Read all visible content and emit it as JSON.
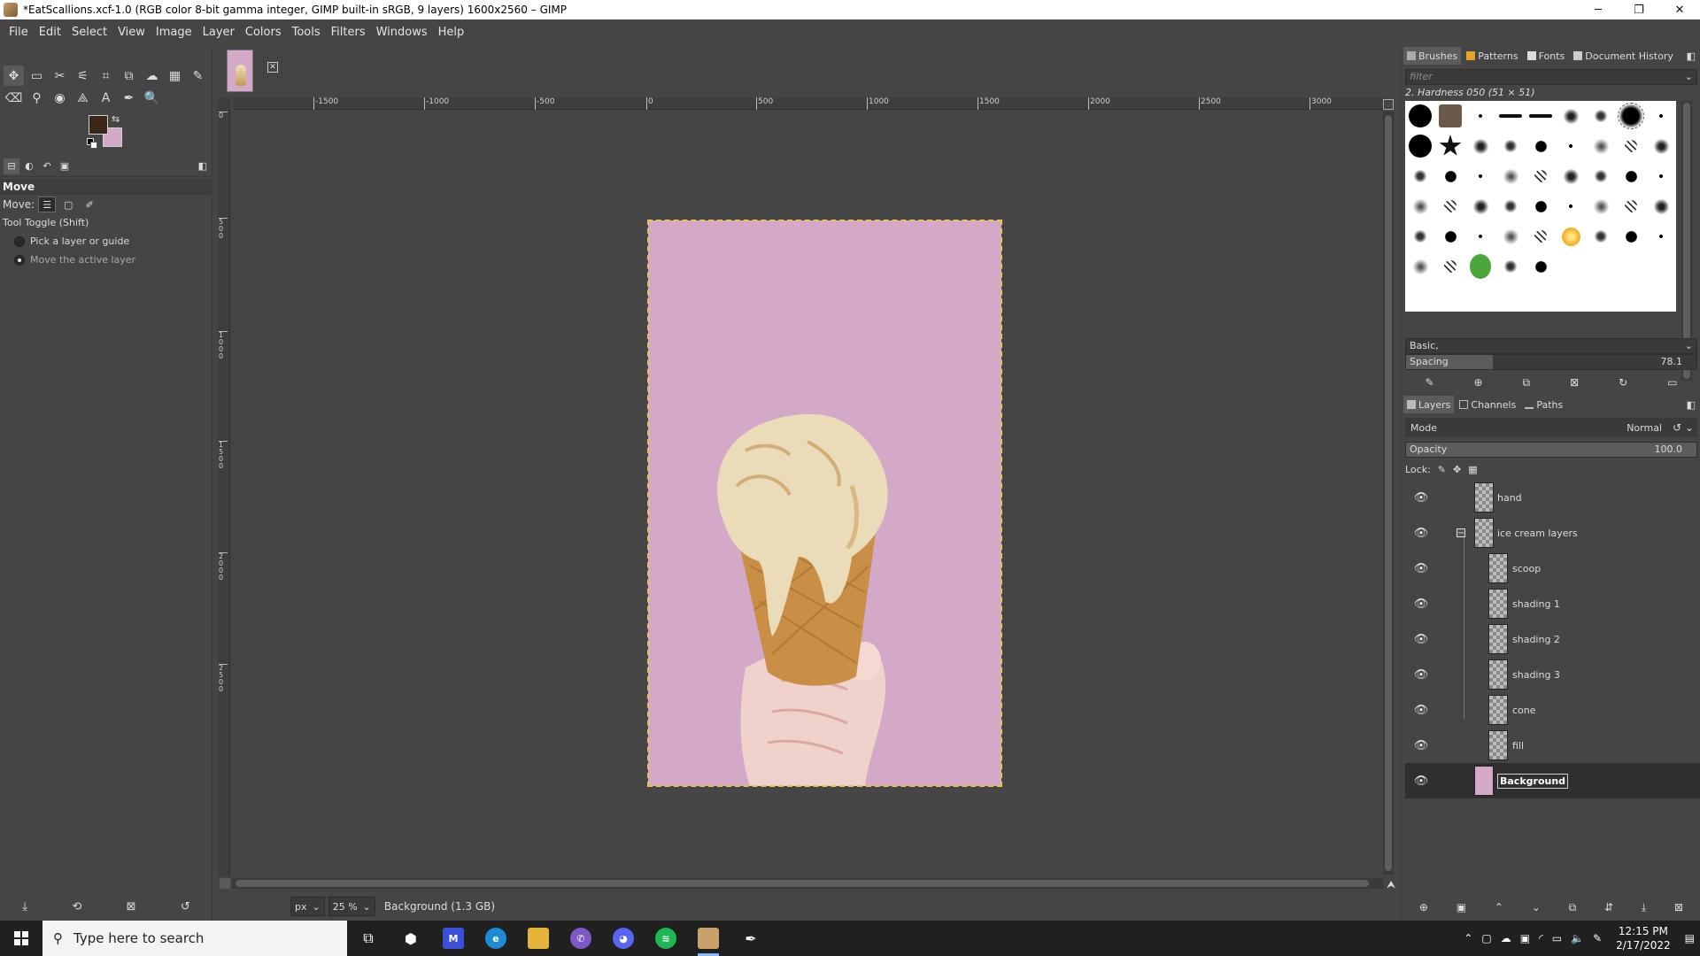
{
  "window": {
    "title": "*EatScallions.xcf-1.0 (RGB color 8-bit gamma integer, GIMP built-in sRGB, 9 layers) 1600x2560 – GIMP",
    "minimize": "─",
    "maximize": "❐",
    "close": "✕"
  },
  "menu": [
    "File",
    "Edit",
    "Select",
    "View",
    "Image",
    "Layer",
    "Colors",
    "Tools",
    "Filters",
    "Windows",
    "Help"
  ],
  "toolbox": {
    "row1_icons": [
      "move-icon",
      "rect-select-icon",
      "free-select-icon",
      "fuzzy-select-icon",
      "crop-icon",
      "unified-transform-icon",
      "warp-icon",
      "gradient-icon",
      "smudge-icon"
    ],
    "row2_icons": [
      "eraser-icon",
      "clone-icon",
      "bucket-fill-icon",
      "perspective-icon",
      "text-icon",
      "color-picker-icon",
      "zoom-icon"
    ],
    "fg_color": "#3a2718",
    "bg_color": "#d4a8c7"
  },
  "tool_options": {
    "title": "Move",
    "move_label": "Move:",
    "toggle_label": "Tool Toggle  (Shift)",
    "radio1": "Pick a layer or guide",
    "radio2": "Move the active layer"
  },
  "ruler": {
    "h": [
      "-1500",
      "-1000",
      "-500",
      "0",
      "500",
      "1000",
      "1500",
      "2000",
      "2500",
      "3000"
    ],
    "v": [
      "0",
      "500",
      "1000",
      "1500",
      "2000",
      "2500"
    ]
  },
  "status": {
    "unit": "px",
    "zoom": "25 %",
    "message": "Background (1.3 GB)"
  },
  "brushes": {
    "tabs": [
      "Brushes",
      "Patterns",
      "Fonts",
      "Document History"
    ],
    "filter_placeholder": "filter",
    "current": "2. Hardness 050 (51 × 51)",
    "preset": "Basic,",
    "spacing_label": "Spacing",
    "spacing_value": "78.1"
  },
  "layers": {
    "tabs": [
      "Layers",
      "Channels",
      "Paths"
    ],
    "mode_label": "Mode",
    "mode_value": "Normal",
    "opacity_label": "Opacity",
    "opacity_value": "100.0",
    "lock_label": "Lock:",
    "items": [
      {
        "name": "hand",
        "level": 0
      },
      {
        "name": "ice cream layers",
        "level": 0,
        "group": true
      },
      {
        "name": "scoop",
        "level": 1
      },
      {
        "name": "shading 1",
        "level": 1
      },
      {
        "name": "shading 2",
        "level": 1
      },
      {
        "name": "shading 3",
        "level": 1
      },
      {
        "name": "cone",
        "level": 1
      },
      {
        "name": "fill",
        "level": 1
      },
      {
        "name": "Background",
        "level": 0,
        "active": true
      }
    ]
  },
  "taskbar": {
    "search_placeholder": "Type here to search",
    "time": "12:15 PM",
    "date": "2/17/2022"
  }
}
